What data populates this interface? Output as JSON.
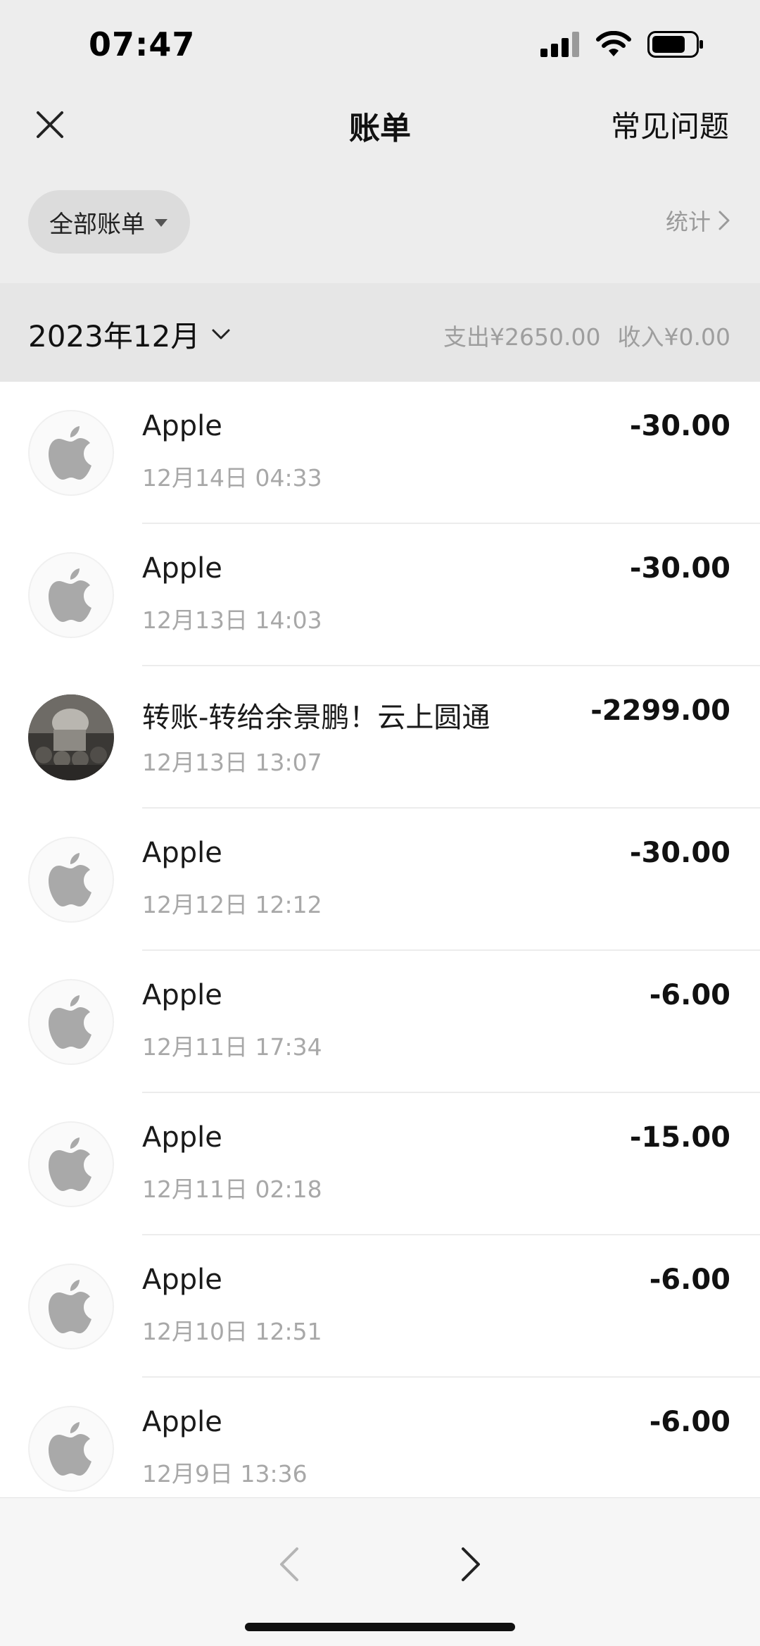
{
  "status_bar": {
    "time": "07:47"
  },
  "nav": {
    "title": "账单",
    "right_link": "常见问题"
  },
  "filter": {
    "selected": "全部账单",
    "stats_label": "统计"
  },
  "month": {
    "label": "2023年12月",
    "expense": "支出¥2650.00",
    "income": "收入¥0.00"
  },
  "transactions": [
    {
      "name": "Apple",
      "time": "12月14日 04:33",
      "amount": "-30.00",
      "avatar": "apple-icon"
    },
    {
      "name": "Apple",
      "time": "12月13日 14:03",
      "amount": "-30.00",
      "avatar": "apple-icon"
    },
    {
      "name": "转账-转给余景鹏！云上圆通",
      "time": "12月13日 13:07",
      "amount": "-2299.00",
      "avatar": "photo"
    },
    {
      "name": "Apple",
      "time": "12月12日 12:12",
      "amount": "-30.00",
      "avatar": "apple-icon"
    },
    {
      "name": "Apple",
      "time": "12月11日 17:34",
      "amount": "-6.00",
      "avatar": "apple-icon"
    },
    {
      "name": "Apple",
      "time": "12月11日 02:18",
      "amount": "-15.00",
      "avatar": "apple-icon"
    },
    {
      "name": "Apple",
      "time": "12月10日 12:51",
      "amount": "-6.00",
      "avatar": "apple-icon"
    },
    {
      "name": "Apple",
      "time": "12月9日 13:36",
      "amount": "-6.00",
      "avatar": "apple-icon"
    }
  ],
  "icons": {
    "close": "close-icon",
    "filter_caret": "caret-down-icon",
    "stats_chevron": "chevron-right-icon",
    "month_chevron": "chevron-down-icon",
    "prev": "chevron-left-icon",
    "next": "chevron-right-icon"
  },
  "colors": {
    "background": "#ededed",
    "list_background": "#ffffff",
    "secondary_text": "#a8a8a8",
    "pill": "#dcdcdc"
  }
}
